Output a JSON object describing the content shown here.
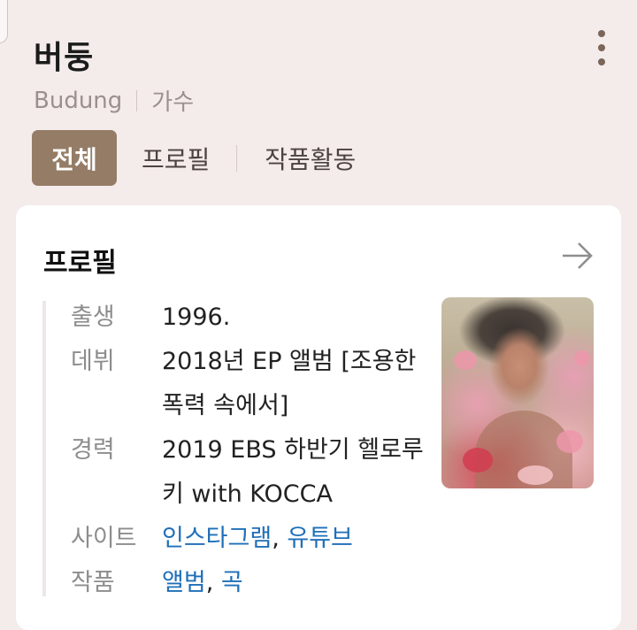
{
  "header": {
    "title": "버둥",
    "subtitle_name": "Budung",
    "subtitle_role": "가수"
  },
  "tabs": [
    {
      "label": "전체",
      "active": true
    },
    {
      "label": "프로필",
      "active": false
    },
    {
      "label": "작품활동",
      "active": false
    }
  ],
  "profile": {
    "title": "프로필",
    "rows": [
      {
        "label": "출생",
        "value": "1996."
      },
      {
        "label": "데뷔",
        "value": "2018년 EP 앨범 [조용한 폭력 속에서]"
      },
      {
        "label": "경력",
        "value": "2019 EBS 하반기 헬로루키 with KOCCA"
      },
      {
        "label": "사이트",
        "link1": "인스타그램",
        "sep": ", ",
        "link2": "유튜브"
      },
      {
        "label": "작품",
        "link1": "앨범",
        "sep": ", ",
        "link2": "곡"
      }
    ]
  },
  "icons": {
    "menu": "more-vertical-icon",
    "arrow": "arrow-right-icon"
  },
  "colors": {
    "accent": "#957c66",
    "link": "#1f6fb8",
    "background": "#f4ebeb"
  }
}
